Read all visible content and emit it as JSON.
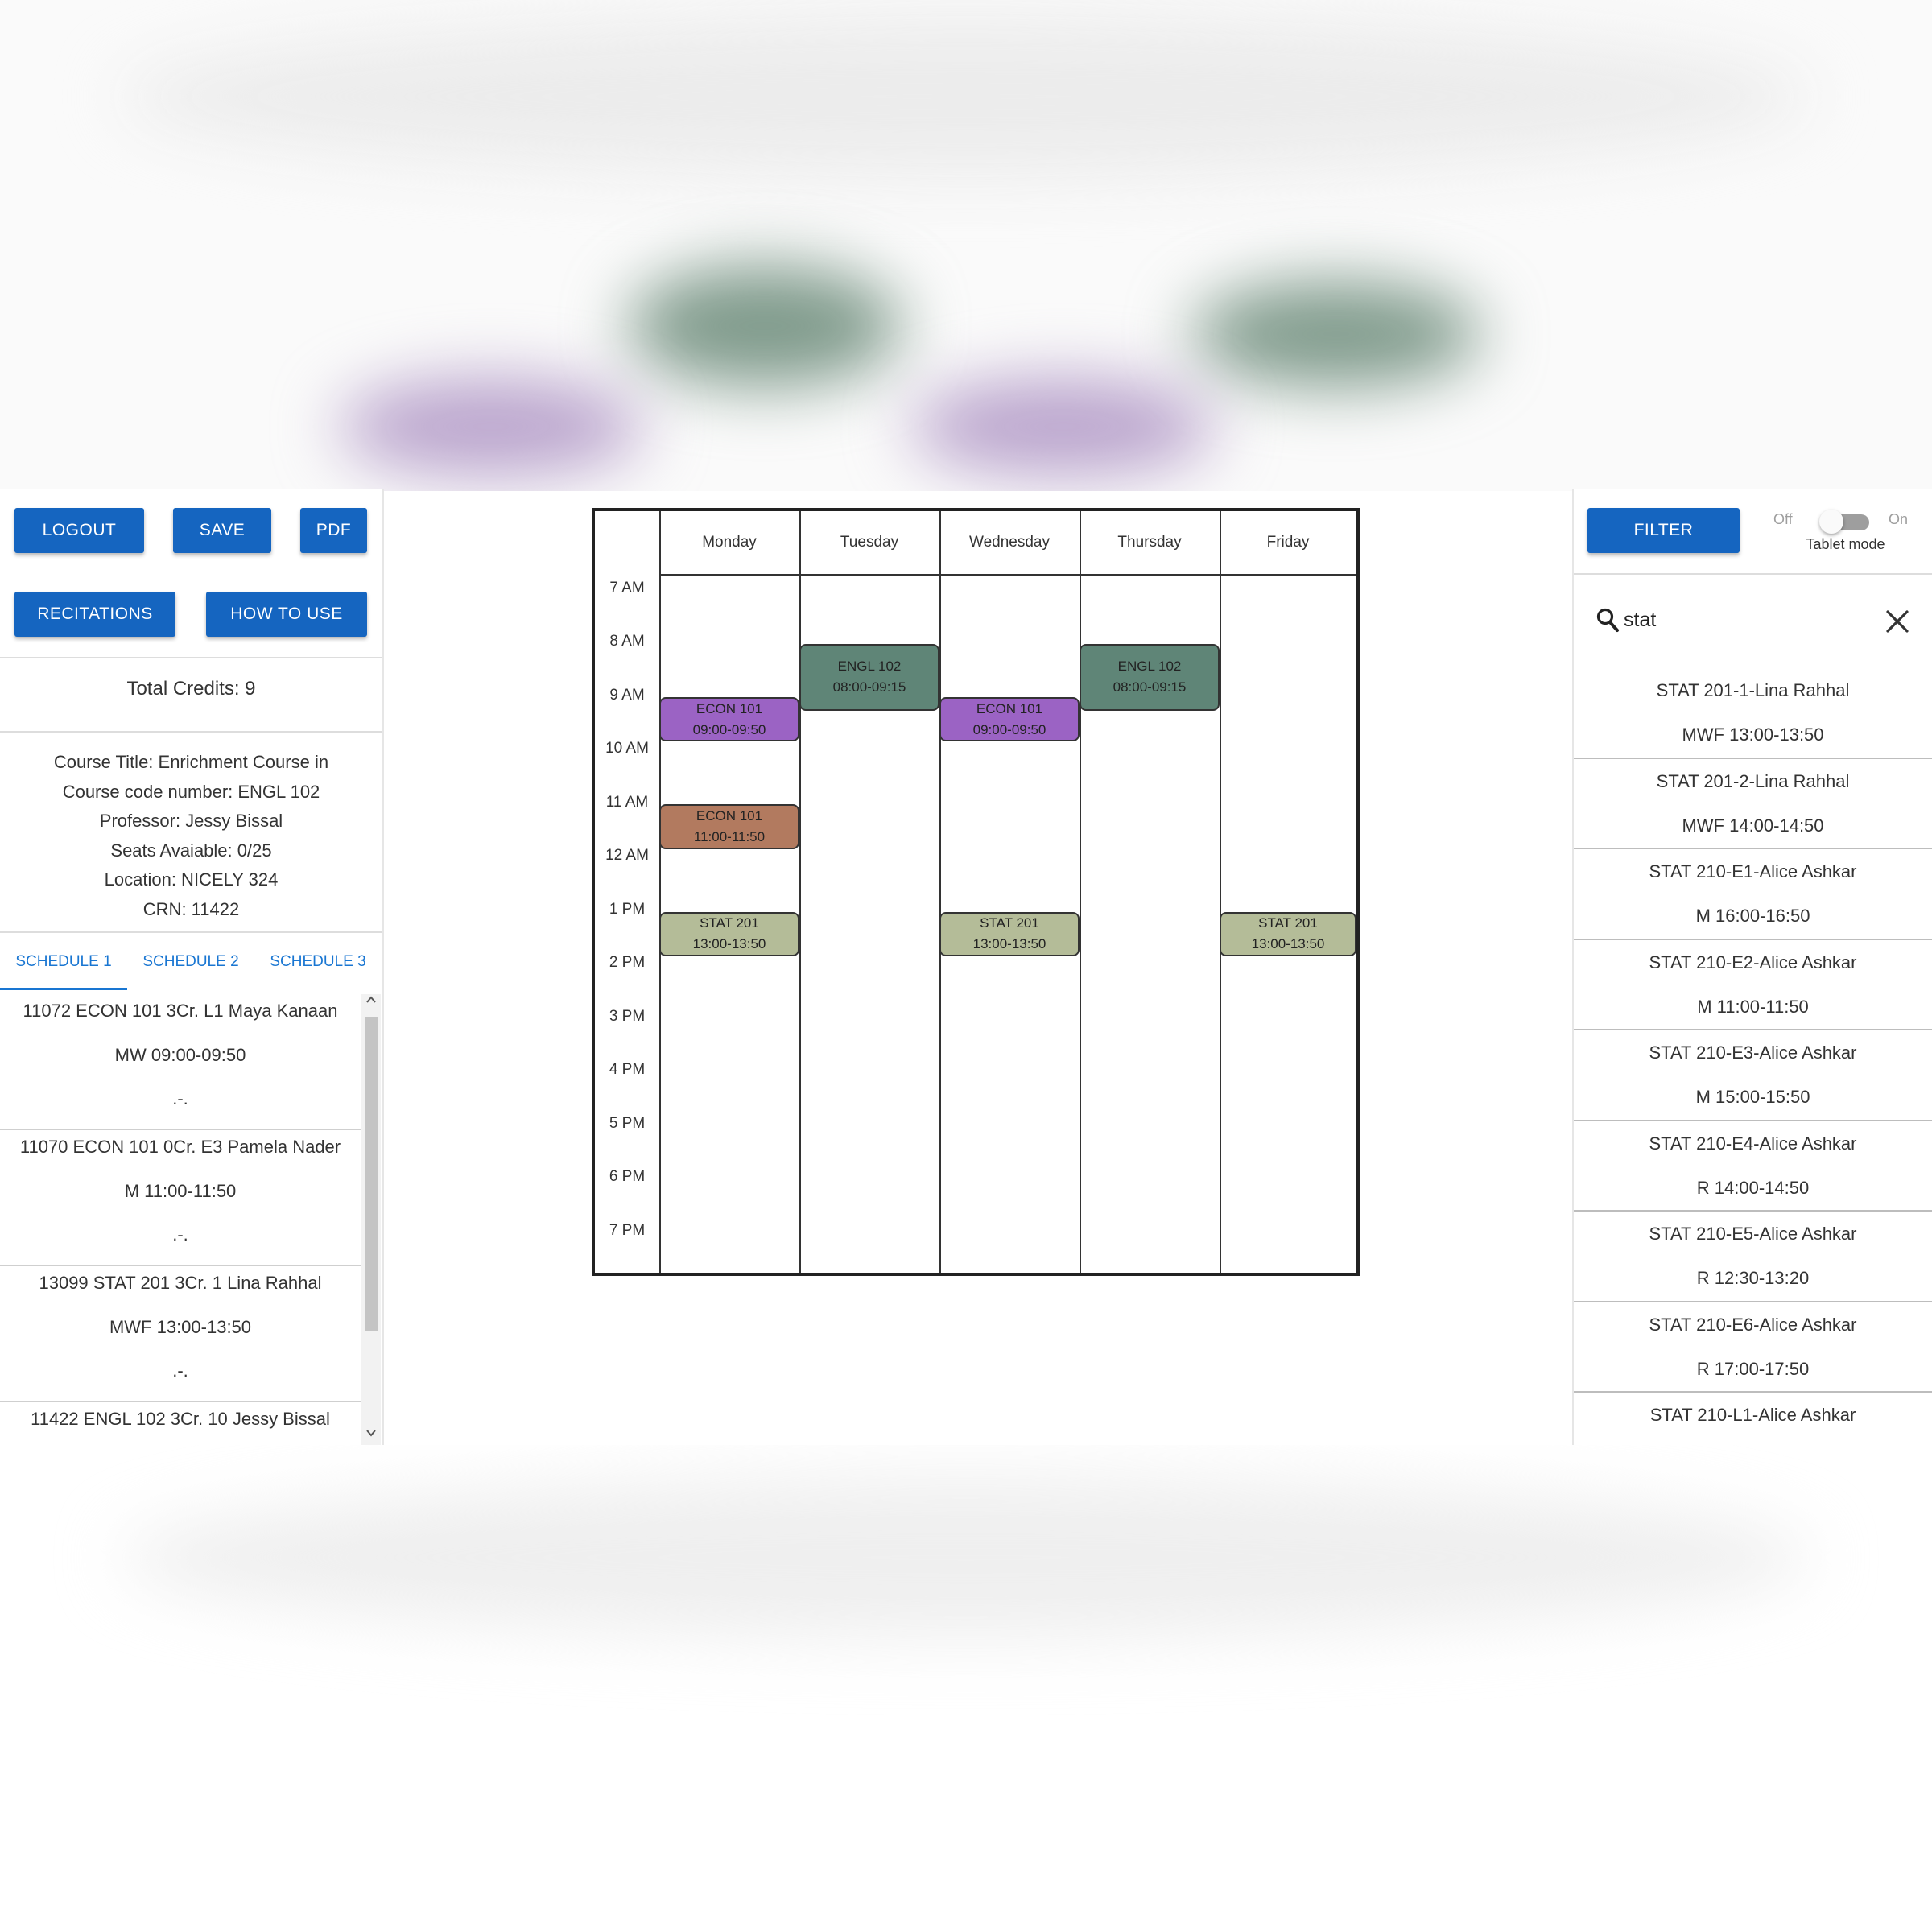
{
  "toolbar": {
    "logout": "LOGOUT",
    "save": "SAVE",
    "pdf": "PDF",
    "recitations": "RECITATIONS",
    "how_to_use": "HOW TO USE",
    "filter": "FILTER"
  },
  "summary": {
    "total_credits": "Total Credits: 9"
  },
  "course_info": [
    "Course Title: Enrichment Course in",
    "Course code number: ENGL 102",
    "Professor: Jessy Bissal",
    "Seats Avaiable: 0/25",
    "Location: NICELY 324",
    "CRN: 11422"
  ],
  "tabs": [
    "SCHEDULE 1",
    "SCHEDULE 2",
    "SCHEDULE 3"
  ],
  "schedule_items": [
    {
      "title": "11072 ECON 101 3Cr. L1 Maya Kanaan",
      "time": "MW 09:00-09:50",
      "extra": ".-."
    },
    {
      "title": "11070 ECON 101 0Cr. E3 Pamela Nader",
      "time": "M 11:00-11:50",
      "extra": ".-."
    },
    {
      "title": "13099 STAT 201 3Cr. 1 Lina Rahhal",
      "time": "MWF 13:00-13:50",
      "extra": ".-."
    },
    {
      "title": "11422 ENGL 102 3Cr. 10 Jessy Bissal",
      "time": "",
      "extra": ""
    }
  ],
  "calendar": {
    "days": [
      "Monday",
      "Tuesday",
      "Wednesday",
      "Thursday",
      "Friday"
    ],
    "times": [
      "7 AM",
      "8 AM",
      "9 AM",
      "10 AM",
      "11 AM",
      "12 AM",
      "1 PM",
      "2 PM",
      "3 PM",
      "4 PM",
      "5 PM",
      "6 PM",
      "7 PM"
    ],
    "events": [
      {
        "name": "ECON 101",
        "time": "09:00-09:50",
        "day": 0,
        "start": 9.0,
        "end": 9.83,
        "color": "#9b63c4"
      },
      {
        "name": "ECON 101",
        "time": "09:00-09:50",
        "day": 2,
        "start": 9.0,
        "end": 9.83,
        "color": "#9b63c4"
      },
      {
        "name": "ENGL 102",
        "time": "08:00-09:15",
        "day": 1,
        "start": 8.0,
        "end": 9.25,
        "color": "#5f8577"
      },
      {
        "name": "ENGL 102",
        "time": "08:00-09:15",
        "day": 3,
        "start": 8.0,
        "end": 9.25,
        "color": "#5f8577"
      },
      {
        "name": "ECON 101",
        "time": "11:00-11:50",
        "day": 0,
        "start": 11.0,
        "end": 11.83,
        "color": "#b27a5f"
      },
      {
        "name": "STAT 201",
        "time": "13:00-13:50",
        "day": 0,
        "start": 13.0,
        "end": 13.83,
        "color": "#b4bc98"
      },
      {
        "name": "STAT 201",
        "time": "13:00-13:50",
        "day": 2,
        "start": 13.0,
        "end": 13.83,
        "color": "#b4bc98"
      },
      {
        "name": "STAT 201",
        "time": "13:00-13:50",
        "day": 4,
        "start": 13.0,
        "end": 13.83,
        "color": "#b4bc98"
      }
    ]
  },
  "tablet_mode": {
    "off": "Off",
    "on": "On",
    "label": "Tablet mode",
    "enabled": false
  },
  "search": {
    "value": "stat"
  },
  "results": [
    {
      "title": "STAT 201-1-Lina Rahhal",
      "time": "MWF 13:00-13:50"
    },
    {
      "title": "STAT 201-2-Lina Rahhal",
      "time": "MWF 14:00-14:50"
    },
    {
      "title": "STAT 210-E1-Alice Ashkar",
      "time": "M 16:00-16:50"
    },
    {
      "title": "STAT 210-E2-Alice Ashkar",
      "time": "M 11:00-11:50"
    },
    {
      "title": "STAT 210-E3-Alice Ashkar",
      "time": "M 15:00-15:50"
    },
    {
      "title": "STAT 210-E4-Alice Ashkar",
      "time": "R 14:00-14:50"
    },
    {
      "title": "STAT 210-E5-Alice Ashkar",
      "time": "R 12:30-13:20"
    },
    {
      "title": "STAT 210-E6-Alice Ashkar",
      "time": "R 17:00-17:50"
    },
    {
      "title": "STAT 210-L1-Alice Ashkar",
      "time": ""
    }
  ],
  "colors": {
    "primary": "#1565c0",
    "tab_accent": "#1976d2"
  },
  "icons": [
    "search-icon",
    "close-icon",
    "chevron-up-icon",
    "chevron-down-icon"
  ]
}
